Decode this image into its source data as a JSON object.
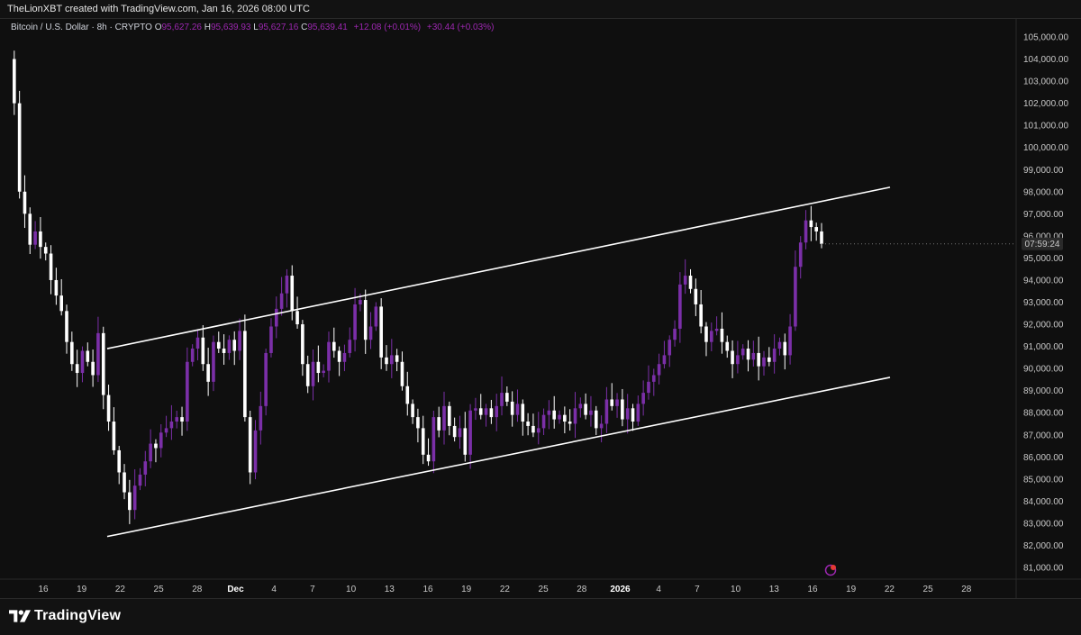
{
  "header": {
    "attribution": "TheLionXBT created with TradingView.com, Jan 16, 2026 08:00 UTC"
  },
  "legend": {
    "symbol": "Bitcoin / U.S. Dollar · 8h · CRYPTO",
    "o_label": "O",
    "o_value": "95,627.26",
    "h_label": "H",
    "h_value": "95,639.93",
    "l_label": "L",
    "l_value": "95,627.16",
    "c_label": "C",
    "c_value": "95,639.41",
    "change": "+12.08 (+0.01%)",
    "change2": "+30.44 (+0.03%)"
  },
  "countdown": "07:59:24",
  "footer": {
    "brand": "TradingView"
  },
  "colors": {
    "background": "#0f0f0f",
    "up_candle": "#7b2fa8",
    "down_candle": "#ffffff",
    "channel_line": "#ffffff",
    "axis_text": "#c8c8c8"
  },
  "chart_data": {
    "type": "candlestick",
    "title": "Bitcoin / U.S. Dollar · 8h · CRYPTO",
    "ylim": [
      80500,
      105600
    ],
    "y_ticks": [
      "105,000.00",
      "104,000.00",
      "103,000.00",
      "102,000.00",
      "101,000.00",
      "100,000.00",
      "99,000.00",
      "98,000.00",
      "97,000.00",
      "96,000.00",
      "95,000.00",
      "94,000.00",
      "93,000.00",
      "92,000.00",
      "91,000.00",
      "90,000.00",
      "89,000.00",
      "88,000.00",
      "87,000.00",
      "86,000.00",
      "85,000.00",
      "84,000.00",
      "83,000.00",
      "82,000.00",
      "81,000.00"
    ],
    "x_ticks": [
      "16",
      "19",
      "22",
      "25",
      "28",
      "Dec",
      "4",
      "7",
      "10",
      "13",
      "16",
      "19",
      "22",
      "25",
      "28",
      "2026",
      "4",
      "7",
      "10",
      "13",
      "16",
      "19",
      "22",
      "25",
      "28"
    ],
    "x_ticks_bold": [
      "Dec",
      "2026"
    ],
    "price_path": [
      104000,
      102000,
      98000,
      97000,
      95600,
      96200,
      95500,
      95200,
      94000,
      93300,
      92600,
      91200,
      90200,
      89800,
      90800,
      90300,
      89700,
      91600,
      88800,
      87600,
      86300,
      85300,
      84400,
      83600,
      84700,
      85200,
      85800,
      86600,
      86400,
      87100,
      87300,
      87600,
      87800,
      87600,
      90300,
      90900,
      91400,
      90200,
      89400,
      91200,
      90900,
      90700,
      91300,
      90800,
      91700,
      87800,
      85300,
      87200,
      88300,
      90700,
      91900,
      92700,
      93400,
      94200,
      92600,
      92000,
      90200,
      89200,
      90300,
      89800,
      89900,
      91200,
      90800,
      90300,
      90700,
      91300,
      92900,
      93100,
      91300,
      91900,
      92800,
      90500,
      90200,
      90600,
      90300,
      89200,
      88400,
      87800,
      87300,
      86100,
      85800,
      87800,
      87200,
      88300,
      87400,
      86900,
      87300,
      86100,
      88100,
      88200,
      87900,
      88200,
      87800,
      88300,
      88900,
      88500,
      87900,
      88400,
      87600,
      87400,
      87100,
      87300,
      87900,
      88100,
      87700,
      87900,
      87600,
      87500,
      88200,
      88400,
      87900,
      88100,
      87300,
      87500,
      88600,
      88300,
      88600,
      87700,
      88200,
      87600,
      88400,
      88900,
      89400,
      89700,
      90200,
      90600,
      91300,
      91800,
      93800,
      94200,
      93600,
      92900,
      91900,
      91200,
      91700,
      91800,
      91200,
      90800,
      90200,
      90600,
      90900,
      90400,
      90700,
      90100,
      90500,
      90300,
      90900,
      91200,
      90600,
      91900,
      94600,
      95700,
      96700,
      96400,
      96200,
      95639
    ],
    "time_range": "Nov 14, 2025 – Jan 16, 2026 (8h candles)",
    "channel": {
      "upper": [
        {
          "date": "Nov 21, 2025",
          "price": 90900
        },
        {
          "date": "Jan 21, 2026",
          "price": 98200
        }
      ],
      "lower": [
        {
          "date": "Nov 21, 2025",
          "price": 82400
        },
        {
          "date": "Jan 21, 2026",
          "price": 89600
        }
      ]
    },
    "last_price": 95639.41
  }
}
